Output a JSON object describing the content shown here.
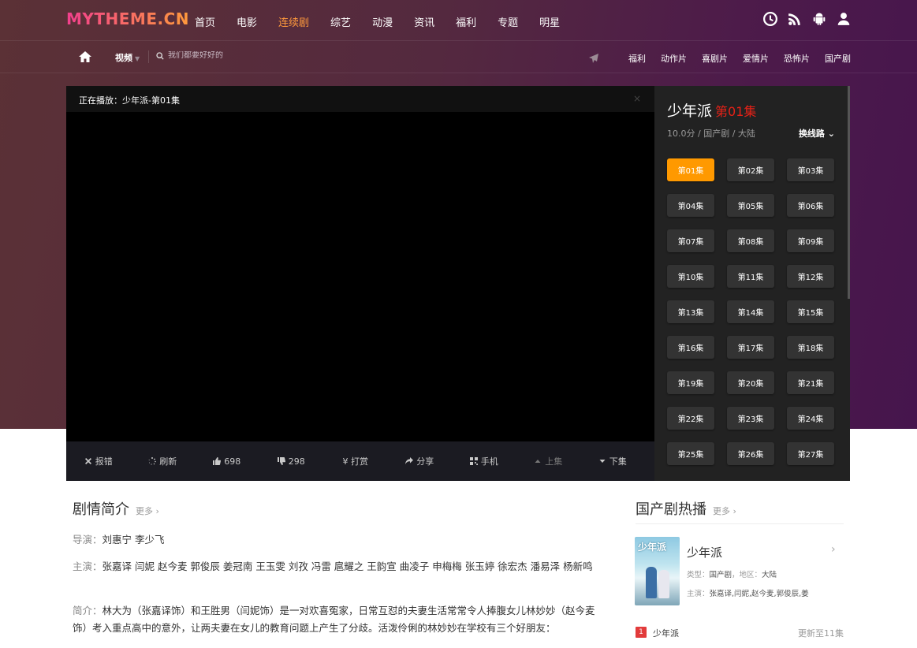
{
  "brand": {
    "logo": "MYTHEME.CN"
  },
  "main_menu": [
    {
      "label": "首页",
      "active": false
    },
    {
      "label": "电影",
      "active": false
    },
    {
      "label": "连续剧",
      "active": true
    },
    {
      "label": "综艺",
      "active": false
    },
    {
      "label": "动漫",
      "active": false
    },
    {
      "label": "资讯",
      "active": false
    },
    {
      "label": "福利",
      "active": false
    },
    {
      "label": "专题",
      "active": false
    },
    {
      "label": "明星",
      "active": false
    }
  ],
  "top_icons": [
    "clock-icon",
    "rss-icon",
    "android-icon",
    "user-icon"
  ],
  "subnav": {
    "category": "视频",
    "search_placeholder": "我们都要好好的",
    "links": [
      "福利",
      "动作片",
      "喜剧片",
      "爱情片",
      "恐怖片",
      "国产剧"
    ]
  },
  "player": {
    "now_playing": "正在播放：少年派-第01集",
    "close": "×",
    "toolbar": {
      "report": "报错",
      "refresh": "刷新",
      "likes": "698",
      "dislikes": "298",
      "reward": "¥ 打赏",
      "share": "分享",
      "mobile": "手机",
      "prev": "上集",
      "next": "下集"
    }
  },
  "episodes": {
    "title": "少年派",
    "current": "第01集",
    "meta": "10.0分 / 国产剧 / 大陆",
    "switch_line": "换线路",
    "list": [
      "第01集",
      "第02集",
      "第03集",
      "第04集",
      "第05集",
      "第06集",
      "第07集",
      "第08集",
      "第09集",
      "第10集",
      "第11集",
      "第12集",
      "第13集",
      "第14集",
      "第15集",
      "第16集",
      "第17集",
      "第18集",
      "第19集",
      "第20集",
      "第21集",
      "第22集",
      "第23集",
      "第24集",
      "第25集",
      "第26集",
      "第27集"
    ],
    "active_index": 0
  },
  "synopsis": {
    "title": "剧情简介",
    "more": "更多 ›",
    "director_label": "导演：",
    "director": "刘惠宁 李少飞",
    "cast_label": "主演：",
    "cast": "张嘉译 闫妮 赵今麦 郭俊辰 姜冠南 王玉雯 刘孜 冯雷 扈耀之 王韵宣 曲凌子 申梅梅 张玉婷 徐宏杰 潘易泽 杨新鸣",
    "intro_label": "简介：",
    "intro": "林大为（张嘉译饰）和王胜男（闫妮饰）是一对欢喜冤家，日常互怼的夫妻生活常常令人捧腹女儿林妙妙（赵今麦饰）考入重点高中的意外，让两夫妻在女儿的教育问题上产生了分歧。活泼伶俐的林妙妙在学校有三个好朋友："
  },
  "hot": {
    "title": "国产剧热播",
    "more": "更多 ›",
    "featured": {
      "poster_text": "少年派",
      "name": "少年派",
      "type_label": "类型：",
      "type": "国产剧",
      "region_label": "，地区：",
      "region": "大陆",
      "cast_label": "主演：",
      "cast": "张嘉译,闫妮,赵今麦,郭俊辰,姜"
    },
    "ranks": [
      {
        "num": "1",
        "name": "少年派",
        "update": "更新至11集"
      }
    ]
  },
  "colors": {
    "accent": "#ff9900",
    "active_menu": "#ff9a3c",
    "episode_red": "#e62117"
  }
}
